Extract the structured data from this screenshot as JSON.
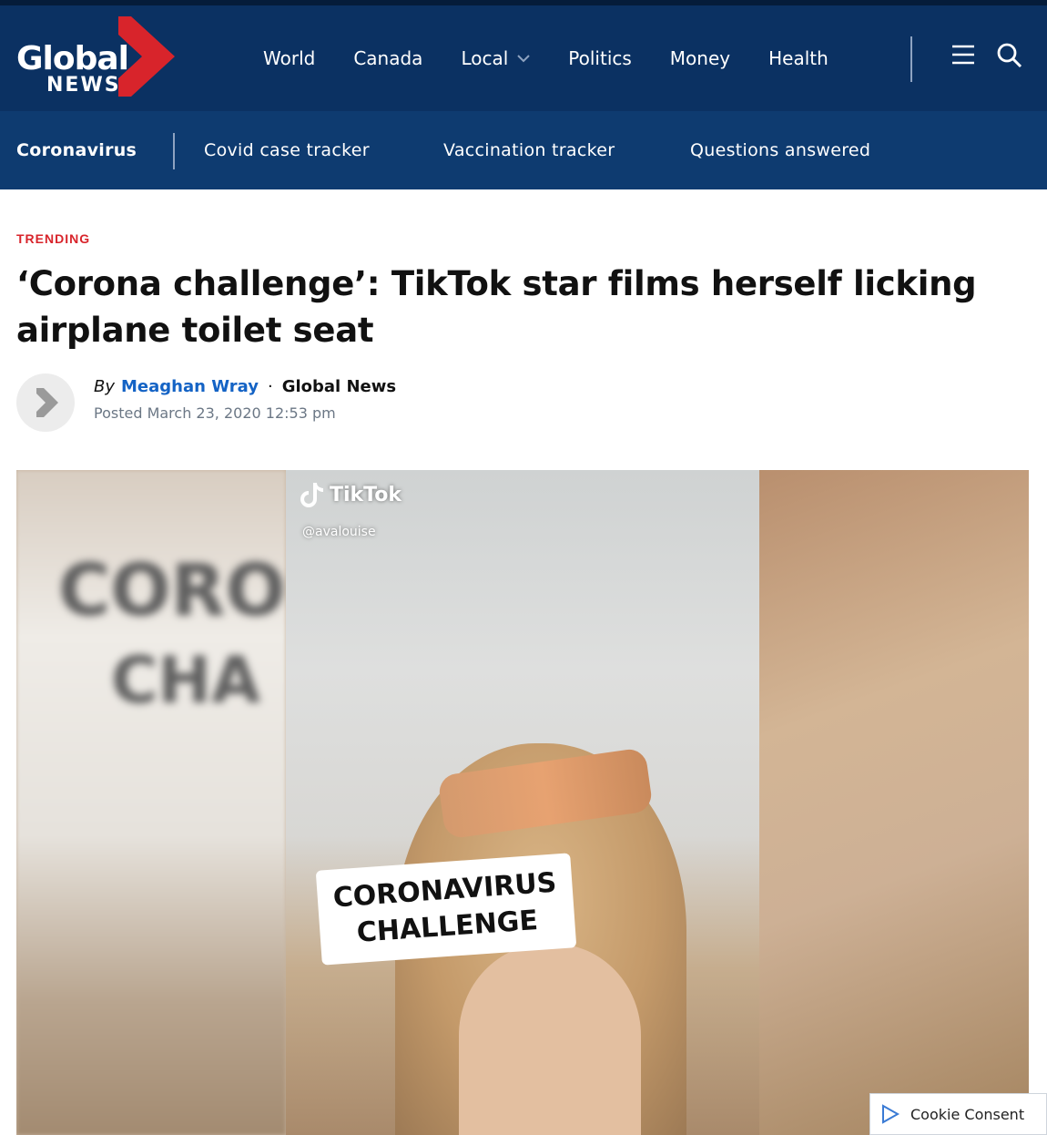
{
  "brand": {
    "logo_word": "Global",
    "logo_sub": "NEWS",
    "logo_icon": "chevron-logo",
    "colors": {
      "nav_bg": "#0b3162",
      "subnav_bg": "#0e3b70",
      "accent_red": "#d8242b",
      "link_blue": "#1463c5"
    }
  },
  "nav": {
    "items": [
      {
        "label": "World"
      },
      {
        "label": "Canada"
      },
      {
        "label": "Local",
        "has_dropdown": true
      },
      {
        "label": "Politics"
      },
      {
        "label": "Money"
      },
      {
        "label": "Health"
      }
    ],
    "menu_icon": "hamburger-menu-icon",
    "search_icon": "search-icon"
  },
  "subnav": {
    "title": "Coronavirus",
    "items": [
      {
        "label": "Covid case tracker"
      },
      {
        "label": "Vaccination tracker"
      },
      {
        "label": "Questions answered"
      }
    ]
  },
  "article": {
    "kicker": "TRENDING",
    "headline": "‘Corona challenge’: TikTok star films herself licking airplane toilet seat",
    "byline_prefix": "By",
    "author": "Meaghan Wray",
    "separator": "·",
    "outlet": "Global News",
    "posted": "Posted March 23, 2020 12:53 pm"
  },
  "hero": {
    "tiktok_label": "TikTok",
    "tiktok_user": "@avalouise",
    "overlay_text_line1": "CORONAVIRUS",
    "overlay_text_line2": "CHALLENGE",
    "blurred_text_line1": "CORO",
    "blurred_text_line2": "CHA"
  },
  "cookie": {
    "label": "Cookie Consent"
  }
}
